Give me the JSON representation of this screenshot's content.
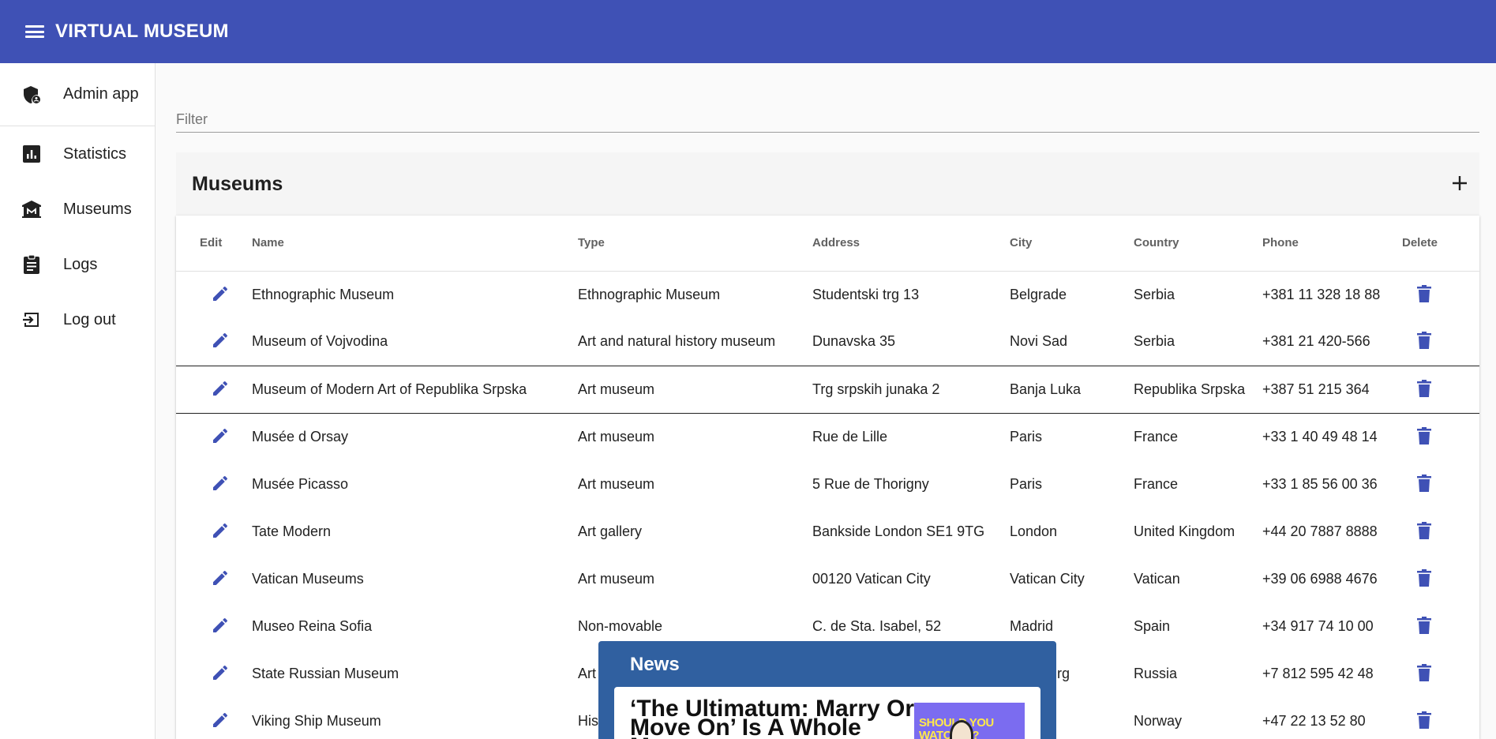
{
  "appbar": {
    "title": "VIRTUAL MUSEUM",
    "menu_icon": "hamburger-menu-icon"
  },
  "sidebar": {
    "items": [
      {
        "label": "Admin app",
        "icon": "admin-shield-icon"
      },
      {
        "label": "Statistics",
        "icon": "bar-chart-icon"
      },
      {
        "label": "Museums",
        "icon": "museum-icon"
      },
      {
        "label": "Logs",
        "icon": "clipboard-icon"
      },
      {
        "label": "Log out",
        "icon": "logout-icon"
      }
    ]
  },
  "filter": {
    "placeholder": "Filter",
    "value": ""
  },
  "card": {
    "title": "Museums",
    "add_icon": "plus-icon"
  },
  "table": {
    "headers": {
      "edit": "Edit",
      "name": "Name",
      "type": "Type",
      "address": "Address",
      "city": "City",
      "country": "Country",
      "phone": "Phone",
      "delete": "Delete"
    },
    "selected_row": 2,
    "rows": [
      {
        "name": "Ethnographic Museum",
        "type": "Ethnographic Museum",
        "address": "Studentski trg 13",
        "city": "Belgrade",
        "country": "Serbia",
        "phone": "+381 11 328 18 88"
      },
      {
        "name": "Museum of Vojvodina",
        "type": "Art and natural history museum",
        "address": "Dunavska 35",
        "city": "Novi Sad",
        "country": "Serbia",
        "phone": "+381 21 420-566"
      },
      {
        "name": "Museum of Modern Art of Republika Srpska",
        "type": "Art museum",
        "address": "Trg srpskih junaka 2",
        "city": "Banja Luka",
        "country": "Republika Srpska",
        "phone": "+387 51 215 364"
      },
      {
        "name": "Musée d Orsay",
        "type": "Art museum",
        "address": "Rue de Lille",
        "city": "Paris",
        "country": "France",
        "phone": "+33 1 40 49 48 14"
      },
      {
        "name": "Musée Picasso",
        "type": "Art museum",
        "address": "5 Rue de Thorigny",
        "city": "Paris",
        "country": "France",
        "phone": "+33 1 85 56 00 36"
      },
      {
        "name": "Tate Modern",
        "type": "Art gallery",
        "address": "Bankside London SE1 9TG",
        "city": "London",
        "country": "United Kingdom",
        "phone": "+44 20 7887 8888"
      },
      {
        "name": "Vatican Museums",
        "type": "Art museum",
        "address": "00120 Vatican City",
        "city": "Vatican City",
        "country": "Vatican",
        "phone": "+39 06 6988 4676"
      },
      {
        "name": "Museo Reina Sofia",
        "type": "Non-movable",
        "address": "C. de Sta. Isabel, 52",
        "city": "Madrid",
        "country": "Spain",
        "phone": "+34 917 74 10 00"
      },
      {
        "name": "State Russian Museum",
        "type": "Art",
        "address": "",
        "city": "etersburg",
        "country": "Russia",
        "phone": "+7 812 595 42 48"
      },
      {
        "name": "Viking Ship Museum",
        "type": "His",
        "address": "",
        "city": "",
        "country": "Norway",
        "phone": "+47 22 13 52 80"
      }
    ]
  },
  "news": {
    "title": "News",
    "headline": "‘The Ultimatum: Marry Or Move On’ Is A Whole Mess",
    "thumb_text": "SHOULD YOU WATCH IT? SHOULD YOU WATCH IT?"
  },
  "colors": {
    "primary": "#3f51b5",
    "news_bg": "#3060a0"
  }
}
